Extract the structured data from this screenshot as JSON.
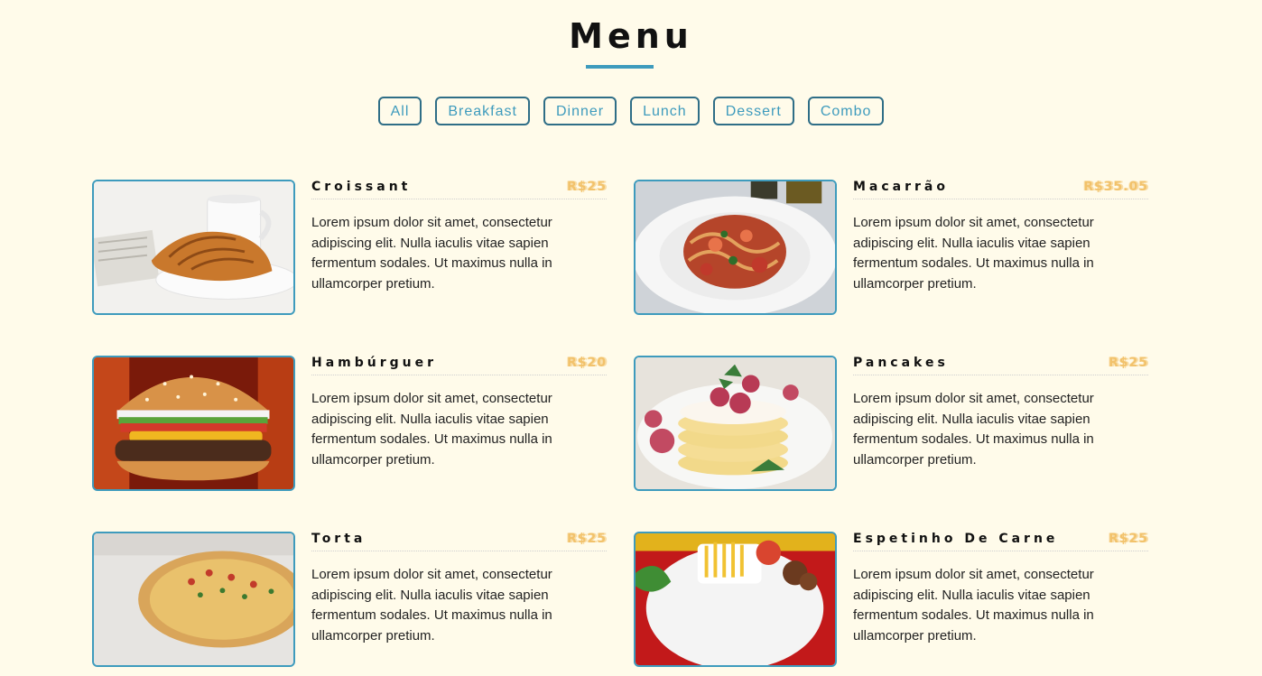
{
  "menu": {
    "title": "Menu",
    "filters": [
      "All",
      "Breakfast",
      "Dinner",
      "Lunch",
      "Dessert",
      "Combo"
    ],
    "items": [
      {
        "name": "Croissant",
        "price": "R$25",
        "image": "croissant-photo",
        "description": "Lorem ipsum dolor sit amet, consectetur adipiscing elit. Nulla iaculis vitae sapien fermentum sodales. Ut maximus nulla in ullamcorper pretium."
      },
      {
        "name": "Macarrão",
        "price": "R$35.05",
        "image": "pasta-photo",
        "description": "Lorem ipsum dolor sit amet, consectetur adipiscing elit. Nulla iaculis vitae sapien fermentum sodales. Ut maximus nulla in ullamcorper pretium."
      },
      {
        "name": "Hambúrguer",
        "price": "R$20",
        "image": "burger-photo",
        "description": "Lorem ipsum dolor sit amet, consectetur adipiscing elit. Nulla iaculis vitae sapien fermentum sodales. Ut maximus nulla in ullamcorper pretium."
      },
      {
        "name": "Pancakes",
        "price": "R$25",
        "image": "pancakes-photo",
        "description": "Lorem ipsum dolor sit amet, consectetur adipiscing elit. Nulla iaculis vitae sapien fermentum sodales. Ut maximus nulla in ullamcorper pretium."
      },
      {
        "name": "Torta",
        "price": "R$25",
        "image": "pizza-photo",
        "description": "Lorem ipsum dolor sit amet, consectetur adipiscing elit. Nulla iaculis vitae sapien fermentum sodales. Ut maximus nulla in ullamcorper pretium."
      },
      {
        "name": "Espetinho De Carne",
        "price": "R$25",
        "image": "skewer-plate-photo",
        "description": "Lorem ipsum dolor sit amet, consectetur adipiscing elit. Nulla iaculis vitae sapien fermentum sodales. Ut maximus nulla in ullamcorper pretium."
      }
    ]
  },
  "colors": {
    "background": "#fffbea",
    "accent": "#3e9bbd",
    "price": "#f2c26b",
    "text": "#222222"
  }
}
